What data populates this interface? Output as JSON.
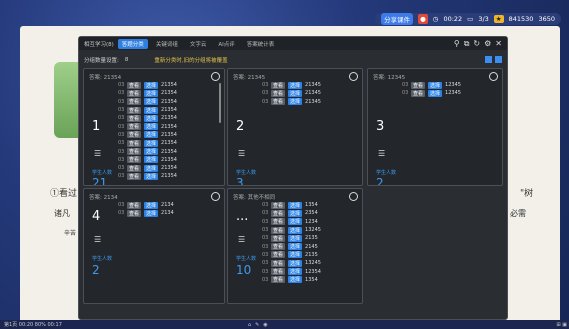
{
  "topbar": {
    "badge": "分享课件",
    "clock": "00:22",
    "pages": "3/3",
    "score": "841530",
    "coins": "3650"
  },
  "doc": {
    "line1": "①看过",
    "line1r": "\"树",
    "line2": "诸凡",
    "line2r": "必需",
    "line3": "辛苦"
  },
  "header": {
    "title": "相互学习(8)",
    "tabs": [
      "答题分类",
      "关键词组",
      "文字云",
      "AI点评",
      "答案统计表"
    ]
  },
  "subbar": {
    "label": "分组数量设置:",
    "count": "8",
    "hint": "重新分类时,旧的分组将被覆盖"
  },
  "cards": [
    {
      "ans": "答案:",
      "answer": "21354",
      "num": "1",
      "flabel": "学生人数",
      "fcount": "21",
      "rows": [
        "21354",
        "21354",
        "21354",
        "21354",
        "21354",
        "21354",
        "21354",
        "21354",
        "21354",
        "21354",
        "21354",
        "21354"
      ]
    },
    {
      "ans": "答案:",
      "answer": "21345",
      "num": "2",
      "flabel": "学生人数",
      "fcount": "3",
      "rows": [
        "21345",
        "21345",
        "21345"
      ]
    },
    {
      "ans": "答案:",
      "answer": "12345",
      "num": "3",
      "flabel": "学生人数",
      "fcount": "2",
      "rows": [
        "12345",
        "12345"
      ]
    },
    {
      "ans": "答案:",
      "answer": "2134",
      "num": "4",
      "flabel": "学生人数",
      "fcount": "2",
      "rows": [
        "2134",
        "2134"
      ]
    },
    {
      "ans": "答案:",
      "answer": "其他不相同",
      "num": "...",
      "flabel": "学生人数",
      "fcount": "10",
      "rows": [
        "1354",
        "2354",
        "1234",
        "13245",
        "2135",
        "2145",
        "2135",
        "13245",
        "12354",
        "1354"
      ]
    }
  ],
  "row_tags": {
    "label": "03",
    "b1": "查看",
    "b2": "选择"
  },
  "taskbar": {
    "left": "第1页 00:20 80% 00:17",
    "right": "⊞ ▣ ☰"
  }
}
